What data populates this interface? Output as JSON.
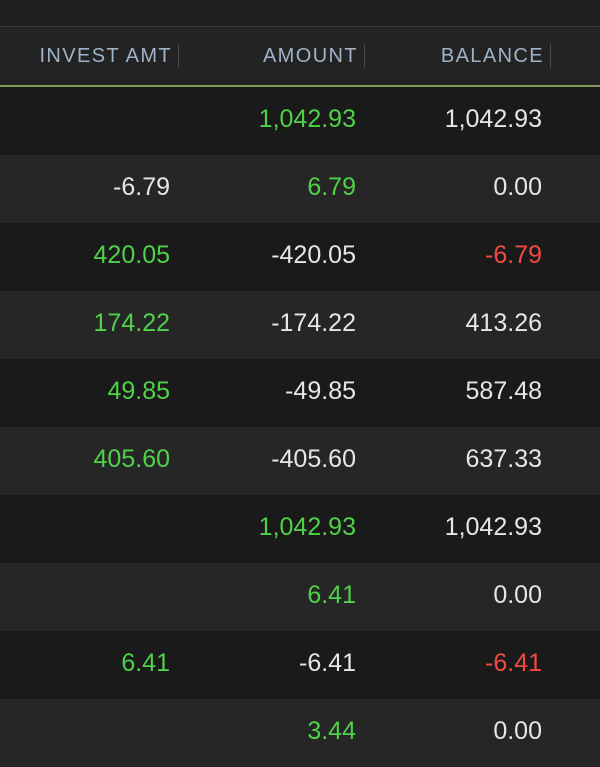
{
  "colors": {
    "positive": "#4fd14a",
    "negative": "#f04a40",
    "neutral": "#e6e6e6",
    "header_text": "#9fb3c8",
    "header_underline": "#7f9a55"
  },
  "header": {
    "invest_amt": "INVEST AMT",
    "amount": "AMOUNT",
    "balance": "BALANCE"
  },
  "rows": [
    {
      "invest": "",
      "invest_color": "neutral",
      "amount": "1,042.93",
      "amount_color": "positive",
      "balance": "1,042.93",
      "balance_color": "neutral"
    },
    {
      "invest": "-6.79",
      "invest_color": "neutral",
      "amount": "6.79",
      "amount_color": "positive",
      "balance": "0.00",
      "balance_color": "neutral"
    },
    {
      "invest": "420.05",
      "invest_color": "positive",
      "amount": "-420.05",
      "amount_color": "neutral",
      "balance": "-6.79",
      "balance_color": "negative"
    },
    {
      "invest": "174.22",
      "invest_color": "positive",
      "amount": "-174.22",
      "amount_color": "neutral",
      "balance": "413.26",
      "balance_color": "neutral"
    },
    {
      "invest": "49.85",
      "invest_color": "positive",
      "amount": "-49.85",
      "amount_color": "neutral",
      "balance": "587.48",
      "balance_color": "neutral"
    },
    {
      "invest": "405.60",
      "invest_color": "positive",
      "amount": "-405.60",
      "amount_color": "neutral",
      "balance": "637.33",
      "balance_color": "neutral"
    },
    {
      "invest": "",
      "invest_color": "neutral",
      "amount": "1,042.93",
      "amount_color": "positive",
      "balance": "1,042.93",
      "balance_color": "neutral"
    },
    {
      "invest": "",
      "invest_color": "neutral",
      "amount": "6.41",
      "amount_color": "positive",
      "balance": "0.00",
      "balance_color": "neutral"
    },
    {
      "invest": "6.41",
      "invest_color": "positive",
      "amount": "-6.41",
      "amount_color": "neutral",
      "balance": "-6.41",
      "balance_color": "negative"
    },
    {
      "invest": "",
      "invest_color": "neutral",
      "amount": "3.44",
      "amount_color": "positive",
      "balance": "0.00",
      "balance_color": "neutral"
    }
  ]
}
